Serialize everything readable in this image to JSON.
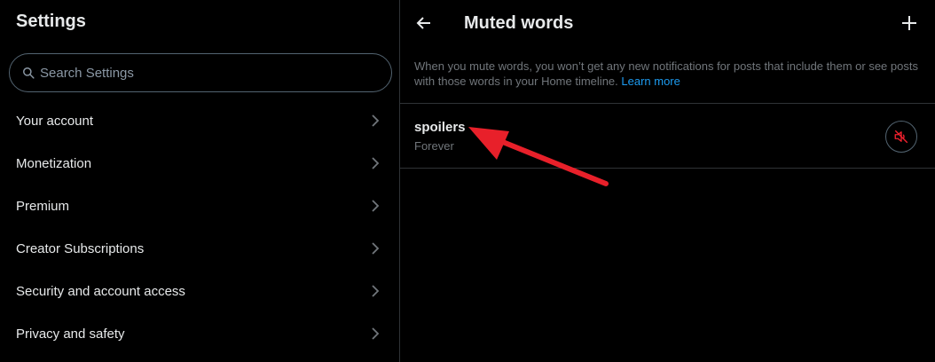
{
  "settings": {
    "title": "Settings",
    "search_placeholder": "Search Settings",
    "items": [
      {
        "label": "Your account"
      },
      {
        "label": "Monetization"
      },
      {
        "label": "Premium"
      },
      {
        "label": "Creator Subscriptions"
      },
      {
        "label": "Security and account access"
      },
      {
        "label": "Privacy and safety"
      }
    ]
  },
  "panel": {
    "title": "Muted words",
    "description": "When you mute words, you won’t get any new notifications for posts that include them or see posts with those words in your Home timeline.",
    "learn_more": "Learn more",
    "muted_words": [
      {
        "word": "spoilers",
        "duration": "Forever"
      }
    ]
  },
  "icons": {
    "search": "search-icon",
    "chevron": "chevron-right-icon",
    "back": "arrow-left-icon",
    "add": "plus-icon",
    "unmute": "speaker-muted-icon"
  },
  "colors": {
    "background": "#000000",
    "text": "#e7e9ea",
    "secondary_text": "#71767b",
    "border": "#2f3336",
    "link": "#1d9bf0",
    "danger": "#f4212e",
    "annotation_arrow": "#e8202a"
  }
}
